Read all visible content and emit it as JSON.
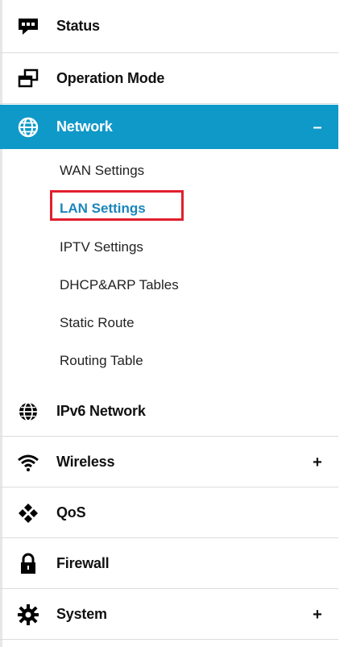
{
  "menu": {
    "items": [
      {
        "label": "Status",
        "icon": "message-bubble-icon",
        "toggle": ""
      },
      {
        "label": "Operation Mode",
        "icon": "windows-icon",
        "toggle": ""
      },
      {
        "label": "Network",
        "icon": "globe-icon",
        "toggle": "–"
      },
      {
        "label": "IPv6 Network",
        "icon": "globe-icon",
        "toggle": ""
      },
      {
        "label": "Wireless",
        "icon": "wifi-icon",
        "toggle": "+"
      },
      {
        "label": "QoS",
        "icon": "network-nodes-icon",
        "toggle": ""
      },
      {
        "label": "Firewall",
        "icon": "lock-icon",
        "toggle": ""
      },
      {
        "label": "System",
        "icon": "gear-icon",
        "toggle": "+"
      }
    ],
    "network_submenu": [
      {
        "label": "WAN Settings"
      },
      {
        "label": "LAN Settings"
      },
      {
        "label": "IPTV Settings"
      },
      {
        "label": "DHCP&ARP Tables"
      },
      {
        "label": "Static Route"
      },
      {
        "label": "Routing Table"
      }
    ],
    "selected_submenu": "LAN Settings",
    "accent_color": "#0f99c9",
    "highlight_color": "#e21f2d",
    "selected_text_color": "#1b85ba"
  }
}
